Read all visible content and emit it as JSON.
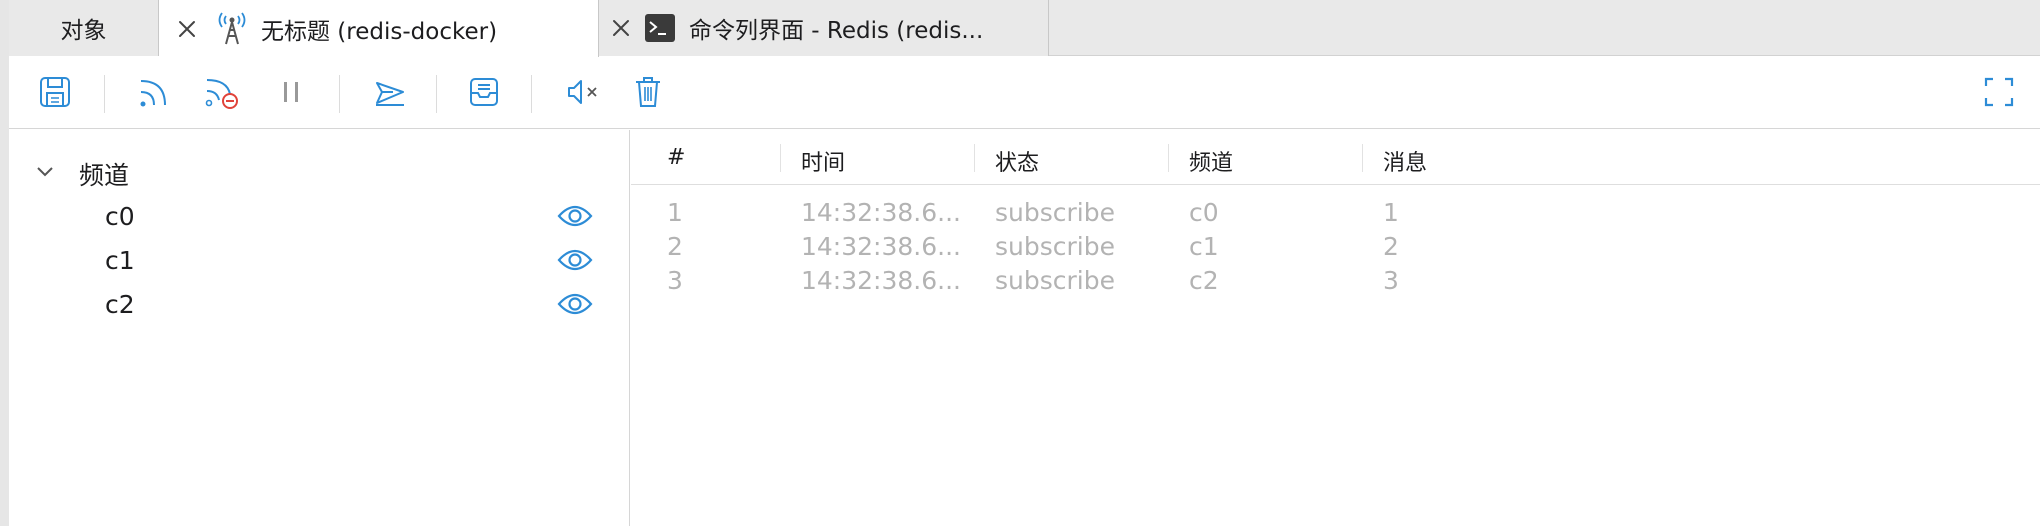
{
  "tabs": [
    {
      "label": "对象"
    },
    {
      "label": "无标题 (redis-docker)",
      "icon": "antenna-tower-icon",
      "active": true
    },
    {
      "label": "命令列界面 - Redis (redis...",
      "icon": "terminal-icon"
    }
  ],
  "toolbar": {
    "buttons": [
      "save-icon",
      "subscribe-icon",
      "unsubscribe-icon",
      "pause-icon",
      "publish-icon",
      "archive-icon",
      "mute-icon",
      "trash-icon",
      "fullscreen-icon"
    ],
    "accent": "#2d8cd6",
    "danger": "#e0433a"
  },
  "sidebar": {
    "group_label": "频道",
    "channels": [
      "c0",
      "c1",
      "c2"
    ]
  },
  "table": {
    "columns": [
      "#",
      "时间",
      "状态",
      "频道",
      "消息"
    ],
    "rows": [
      [
        "1",
        "14:32:38.6...",
        "subscribe",
        "c0",
        "1"
      ],
      [
        "2",
        "14:32:38.6...",
        "subscribe",
        "c1",
        "2"
      ],
      [
        "3",
        "14:32:38.6...",
        "subscribe",
        "c2",
        "3"
      ]
    ]
  }
}
